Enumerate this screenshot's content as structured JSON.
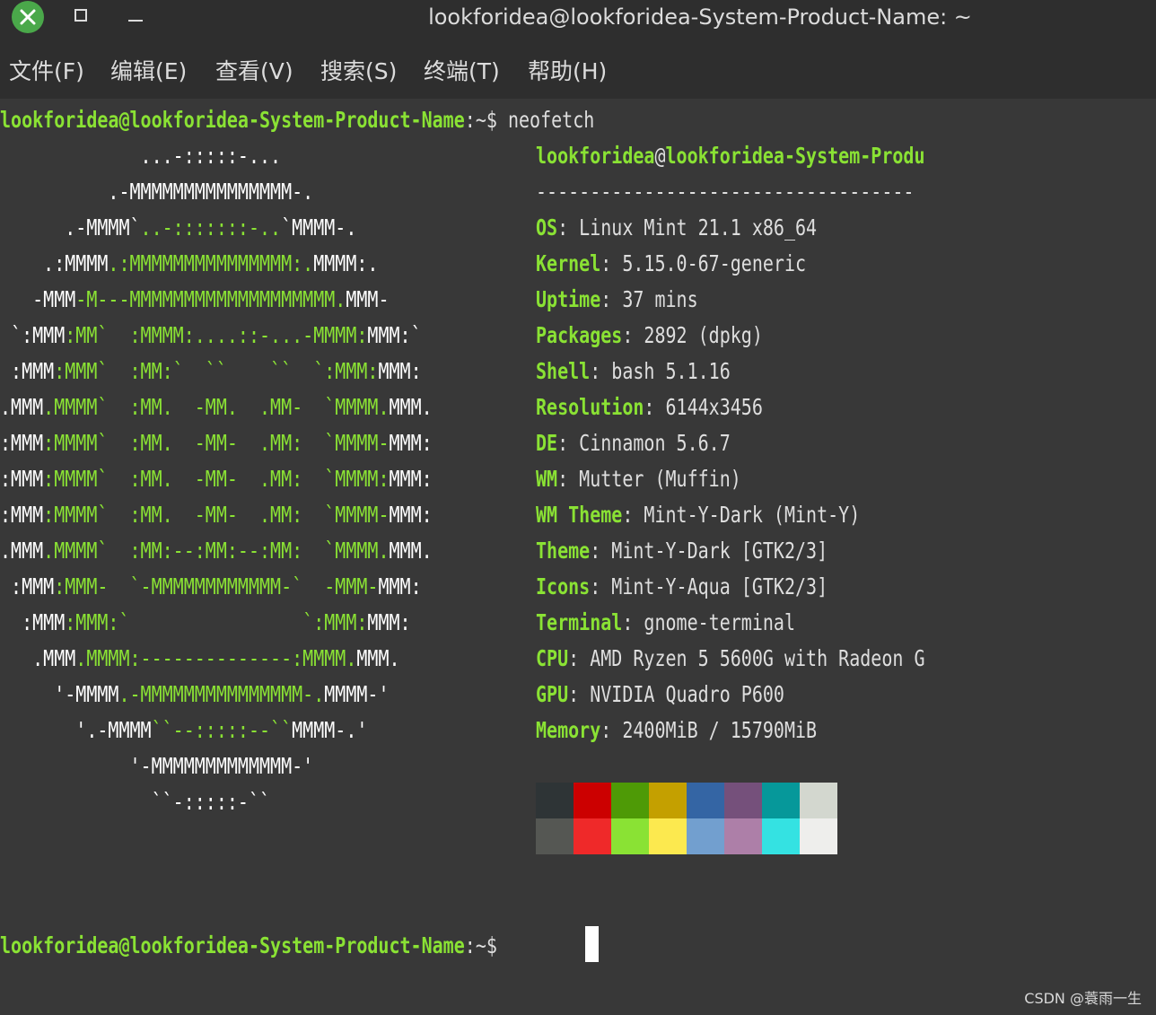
{
  "window": {
    "title": "lookforidea@lookforidea-System-Product-Name: ~",
    "controls": {
      "close": "close-icon",
      "maximize": "maximize-icon",
      "minimize": "minimize-icon"
    }
  },
  "menu": [
    "文件(F)",
    "编辑(E)",
    "查看(V)",
    "搜索(S)",
    "终端(T)",
    "帮助(H)"
  ],
  "prompt": {
    "user_host": "lookforidea@lookforidea-System-Product-Name",
    "cwd": ":~",
    "sign": "$ "
  },
  "command": "neofetch",
  "logo": [
    [
      {
        "t": "             ...-:::::-...",
        "c": "w"
      }
    ],
    [
      {
        "t": "          .-MMMMMMMMMMMMMMM-.",
        "c": "w"
      }
    ],
    [
      {
        "t": "      .-MMMM`",
        "c": "w"
      },
      {
        "t": "..-:::::::-..",
        "c": "gn"
      },
      {
        "t": "`MMMM-.",
        "c": "w"
      }
    ],
    [
      {
        "t": "    .:MMMM",
        "c": "w"
      },
      {
        "t": ".:MMMMMMMMMMMMMMM:.",
        "c": "gn"
      },
      {
        "t": "MMMM:.",
        "c": "w"
      }
    ],
    [
      {
        "t": "   -MMM",
        "c": "w"
      },
      {
        "t": "-M---MMMMMMMMMMMMMMMMMMM.",
        "c": "gn"
      },
      {
        "t": "MMM-",
        "c": "w"
      }
    ],
    [
      {
        "t": " `:MMM",
        "c": "w"
      },
      {
        "t": ":MM`  :MMMM:....::-...-MMMM:",
        "c": "gn"
      },
      {
        "t": "MMM:`",
        "c": "w"
      }
    ],
    [
      {
        "t": " :MMM",
        "c": "w"
      },
      {
        "t": ":MMM`  :MM:`  ``    ``  `:MMM:",
        "c": "gn"
      },
      {
        "t": "MMM:",
        "c": "w"
      }
    ],
    [
      {
        "t": ".MMM",
        "c": "w"
      },
      {
        "t": ".MMMM`  :MM.  -MM.  .MM-  `MMMM.",
        "c": "gn"
      },
      {
        "t": "MMM.",
        "c": "w"
      }
    ],
    [
      {
        "t": ":MMM",
        "c": "w"
      },
      {
        "t": ":MMMM`  :MM.  -MM-  .MM:  `MMMM-",
        "c": "gn"
      },
      {
        "t": "MMM:",
        "c": "w"
      }
    ],
    [
      {
        "t": ":MMM",
        "c": "w"
      },
      {
        "t": ":MMMM`  :MM.  -MM-  .MM:  `MMMM:",
        "c": "gn"
      },
      {
        "t": "MMM:",
        "c": "w"
      }
    ],
    [
      {
        "t": ":MMM",
        "c": "w"
      },
      {
        "t": ":MMMM`  :MM.  -MM-  .MM:  `MMMM-",
        "c": "gn"
      },
      {
        "t": "MMM:",
        "c": "w"
      }
    ],
    [
      {
        "t": ".MMM",
        "c": "w"
      },
      {
        "t": ".MMMM`  :MM:--:MM:--:MM:  `MMMM.",
        "c": "gn"
      },
      {
        "t": "MMM.",
        "c": "w"
      }
    ],
    [
      {
        "t": " :MMM",
        "c": "w"
      },
      {
        "t": ":MMM-  `-MMMMMMMMMMMM-`  -MMM-",
        "c": "gn"
      },
      {
        "t": "MMM:",
        "c": "w"
      }
    ],
    [
      {
        "t": "  :MMM",
        "c": "w"
      },
      {
        "t": ":MMM:`                `:MMM:",
        "c": "gn"
      },
      {
        "t": "MMM:",
        "c": "w"
      }
    ],
    [
      {
        "t": "   .MMM",
        "c": "w"
      },
      {
        "t": ".MMMM:--------------:MMMM.",
        "c": "gn"
      },
      {
        "t": "MMM.",
        "c": "w"
      }
    ],
    [
      {
        "t": "     '-MMMM",
        "c": "w"
      },
      {
        "t": ".-MMMMMMMMMMMMMMM-.",
        "c": "gn"
      },
      {
        "t": "MMMM-'",
        "c": "w"
      }
    ],
    [
      {
        "t": "       '.-MMMM",
        "c": "w"
      },
      {
        "t": "``--:::::--``",
        "c": "gn"
      },
      {
        "t": "MMMM-.'",
        "c": "w"
      }
    ],
    [
      {
        "t": "            '-MMMMMMMMMMMMM-'",
        "c": "w"
      }
    ],
    [
      {
        "t": "              ``-:::::-``",
        "c": "w"
      }
    ]
  ],
  "info_header": {
    "user": "lookforidea",
    "at": "@",
    "host": "lookforidea-System-Produ",
    "separator": "-----------------------------------"
  },
  "info": [
    {
      "key": "OS",
      "value": "Linux Mint 21.1 x86_64"
    },
    {
      "key": "Kernel",
      "value": "5.15.0-67-generic"
    },
    {
      "key": "Uptime",
      "value": "37 mins"
    },
    {
      "key": "Packages",
      "value": "2892 (dpkg)"
    },
    {
      "key": "Shell",
      "value": "bash 5.1.16"
    },
    {
      "key": "Resolution",
      "value": "6144x3456"
    },
    {
      "key": "DE",
      "value": "Cinnamon 5.6.7"
    },
    {
      "key": "WM",
      "value": "Mutter (Muffin)"
    },
    {
      "key": "WM Theme",
      "value": "Mint-Y-Dark (Mint-Y)"
    },
    {
      "key": "Theme",
      "value": "Mint-Y-Dark [GTK2/3]"
    },
    {
      "key": "Icons",
      "value": "Mint-Y-Aqua [GTK2/3]"
    },
    {
      "key": "Terminal",
      "value": "gnome-terminal"
    },
    {
      "key": "CPU",
      "value": "AMD Ryzen 5 5600G with Radeon G"
    },
    {
      "key": "GPU",
      "value": "NVIDIA Quadro P600"
    },
    {
      "key": "Memory",
      "value": "2400MiB / 15790MiB"
    }
  ],
  "palette": {
    "normal": [
      "#2e3436",
      "#cc0000",
      "#4e9a06",
      "#c4a000",
      "#3465a4",
      "#75507b",
      "#06989a",
      "#d3d7cf"
    ],
    "bright": [
      "#555753",
      "#ef2929",
      "#8ae234",
      "#fce94f",
      "#729fcf",
      "#ad7fa8",
      "#34e2e2",
      "#eeeeec"
    ]
  },
  "watermark": "CSDN @蓑雨一生"
}
